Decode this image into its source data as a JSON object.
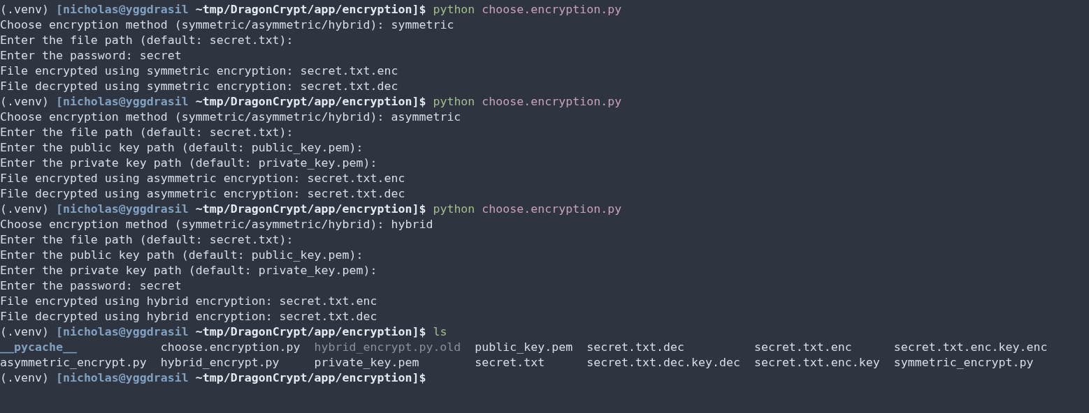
{
  "terminal": {
    "lines": [
      {
        "kind": "prompt",
        "venv": "(.venv)",
        "user": "[nicholas@yggdrasil",
        "path": "~tmp/DragonCrypt/app/encryption]$",
        "command": "python",
        "argument": "choose.encryption.py"
      },
      {
        "kind": "output",
        "text": "Choose encryption method (symmetric/asymmetric/hybrid): symmetric"
      },
      {
        "kind": "output",
        "text": "Enter the file path (default: secret.txt):"
      },
      {
        "kind": "output",
        "text": "Enter the password: secret"
      },
      {
        "kind": "output",
        "text": "File encrypted using symmetric encryption: secret.txt.enc"
      },
      {
        "kind": "output",
        "text": "File decrypted using symmetric encryption: secret.txt.dec"
      },
      {
        "kind": "prompt",
        "venv": "(.venv)",
        "user": "[nicholas@yggdrasil",
        "path": "~tmp/DragonCrypt/app/encryption]$",
        "command": "python",
        "argument": "choose.encryption.py"
      },
      {
        "kind": "output",
        "text": "Choose encryption method (symmetric/asymmetric/hybrid): asymmetric"
      },
      {
        "kind": "output",
        "text": "Enter the file path (default: secret.txt):"
      },
      {
        "kind": "output",
        "text": "Enter the public key path (default: public_key.pem):"
      },
      {
        "kind": "output",
        "text": "Enter the private key path (default: private_key.pem):"
      },
      {
        "kind": "output",
        "text": "File encrypted using asymmetric encryption: secret.txt.enc"
      },
      {
        "kind": "output",
        "text": "File decrypted using asymmetric encryption: secret.txt.dec"
      },
      {
        "kind": "prompt",
        "venv": "(.venv)",
        "user": "[nicholas@yggdrasil",
        "path": "~tmp/DragonCrypt/app/encryption]$",
        "command": "python",
        "argument": "choose.encryption.py"
      },
      {
        "kind": "output",
        "text": "Choose encryption method (symmetric/asymmetric/hybrid): hybrid"
      },
      {
        "kind": "output",
        "text": "Enter the file path (default: secret.txt):"
      },
      {
        "kind": "output",
        "text": "Enter the public key path (default: public_key.pem):"
      },
      {
        "kind": "output",
        "text": "Enter the private key path (default: private_key.pem):"
      },
      {
        "kind": "output",
        "text": "Enter the password: secret"
      },
      {
        "kind": "output",
        "text": "File encrypted using hybrid encryption: secret.txt.enc"
      },
      {
        "kind": "output",
        "text": "File decrypted using hybrid encryption: secret.txt.dec"
      },
      {
        "kind": "prompt",
        "venv": "(.venv)",
        "user": "[nicholas@yggdrasil",
        "path": "~tmp/DragonCrypt/app/encryption]$",
        "command": "ls"
      },
      {
        "kind": "listing",
        "columns": [
          [
            {
              "kind": "dir",
              "name": "__pycache__"
            },
            {
              "kind": "file",
              "name": "asymmetric_encrypt.py"
            }
          ],
          [
            {
              "kind": "file",
              "name": "choose.encryption.py"
            },
            {
              "kind": "file",
              "name": "hybrid_encrypt.py"
            }
          ],
          [
            {
              "kind": "backup",
              "name": "hybrid_encrypt.py.old"
            },
            {
              "kind": "file",
              "name": "private_key.pem"
            }
          ],
          [
            {
              "kind": "file",
              "name": "public_key.pem"
            },
            {
              "kind": "file",
              "name": "secret.txt"
            }
          ],
          [
            {
              "kind": "file",
              "name": "secret.txt.dec"
            },
            {
              "kind": "file",
              "name": "secret.txt.dec.key.dec"
            }
          ],
          [
            {
              "kind": "file",
              "name": "secret.txt.enc"
            },
            {
              "kind": "file",
              "name": "secret.txt.enc.key"
            }
          ],
          [
            {
              "kind": "file",
              "name": "secret.txt.enc.key.enc"
            },
            {
              "kind": "file",
              "name": "symmetric_encrypt.py"
            }
          ]
        ]
      },
      {
        "kind": "prompt",
        "venv": "(.venv)",
        "user": "[nicholas@yggdrasil",
        "path": "~tmp/DragonCrypt/app/encryption]$"
      }
    ]
  }
}
